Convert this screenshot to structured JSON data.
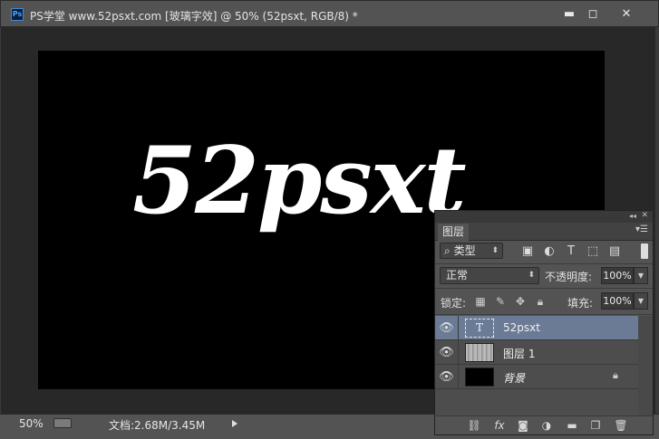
{
  "window": {
    "title": "PS学堂 www.52psxt.com [玻璃字效] @ 50% (52psxt, RGB/8) *",
    "app_icon": "Ps",
    "minimize": "▬",
    "maximize": "◻",
    "close": "✕"
  },
  "canvas": {
    "text": "52psxt",
    "background": "#000000",
    "text_color": "#ffffff"
  },
  "status": {
    "zoom": "50%",
    "doc_info": "文档:2.68M/3.45M"
  },
  "layers_panel": {
    "tab": "图层",
    "collapse": "◂◂",
    "close": "✕",
    "menu": "▾☰",
    "filter_kind": "类型",
    "filter_icons": [
      "image-filter-icon",
      "adjustment-filter-icon",
      "type-filter-icon",
      "shape-filter-icon",
      "smart-object-filter-icon"
    ],
    "blend_mode": "正常",
    "opacity_label": "不透明度:",
    "opacity_value": "100%",
    "lock_label": "锁定:",
    "fill_label": "填充:",
    "fill_value": "100%",
    "layers": [
      {
        "name": "52psxt",
        "type": "text",
        "visible": true,
        "selected": true
      },
      {
        "name": "图层 1",
        "type": "pixel",
        "visible": true,
        "selected": false
      },
      {
        "name": "背景",
        "type": "background",
        "visible": true,
        "selected": false,
        "locked": true
      }
    ],
    "footer_icons": [
      "link-layers-icon",
      "fx-icon",
      "add-mask-icon",
      "adjustment-layer-icon",
      "new-group-icon",
      "new-layer-icon",
      "delete-layer-icon"
    ],
    "selected_color": "#6b7b95"
  }
}
